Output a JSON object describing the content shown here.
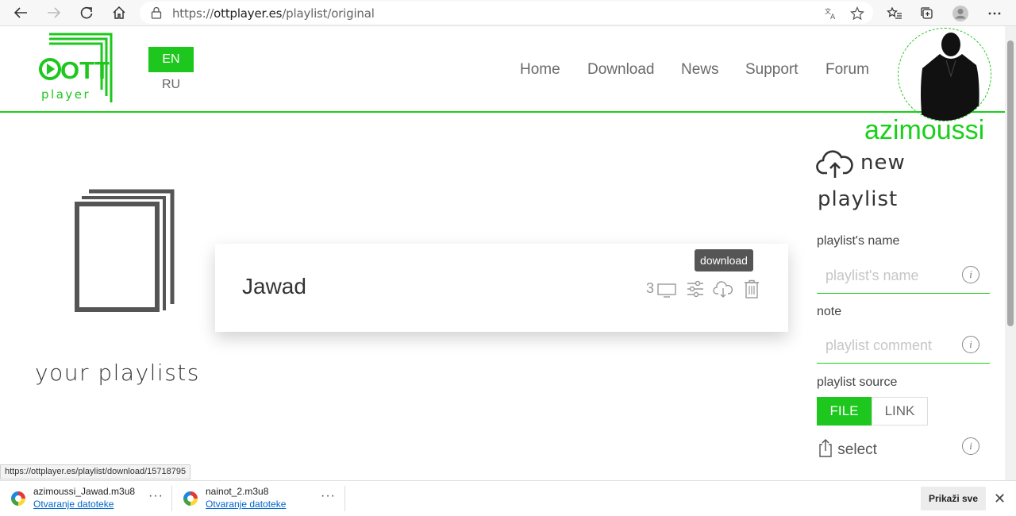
{
  "browser": {
    "url_prefix": "https://",
    "url_host": "ottplayer.es",
    "url_path": "/playlist/original",
    "icons": [
      "back-icon",
      "forward-icon",
      "refresh-icon",
      "home-icon",
      "lock-icon",
      "translate-icon",
      "favorite-star-icon",
      "favorites-icon",
      "collections-icon",
      "profile-icon",
      "more-icon"
    ]
  },
  "header": {
    "logo_ott": "OTT",
    "logo_player": "player",
    "lang_en": "EN",
    "lang_ru": "RU",
    "nav": [
      "Home",
      "Download",
      "News",
      "Support",
      "Forum"
    ],
    "username": "azimoussi"
  },
  "left": {
    "title": "your playlists"
  },
  "card": {
    "name": "Jawad",
    "count": "3",
    "tooltip": "download"
  },
  "right": {
    "new_line1": "new",
    "new_line2": "playlist",
    "name_label": "playlist's name",
    "name_placeholder": "playlist's name",
    "note_label": "note",
    "note_placeholder": "playlist comment",
    "source_label": "playlist source",
    "source_file": "FILE",
    "source_link": "LINK",
    "select_label": "select",
    "info_glyph": "i"
  },
  "status_url": "https://ottplayer.es/playlist/download/15718795",
  "downloads": {
    "items": [
      {
        "name": "azimoussi_Jawad.m3u8",
        "action": "Otvaranje datoteke"
      },
      {
        "name": "nainot_2.m3u8",
        "action": "Otvaranje datoteke"
      }
    ],
    "more": "···",
    "show_all": "Prikaži sve",
    "close": "✕"
  },
  "colors": {
    "accent": "#1ec71e",
    "text": "#333333"
  }
}
